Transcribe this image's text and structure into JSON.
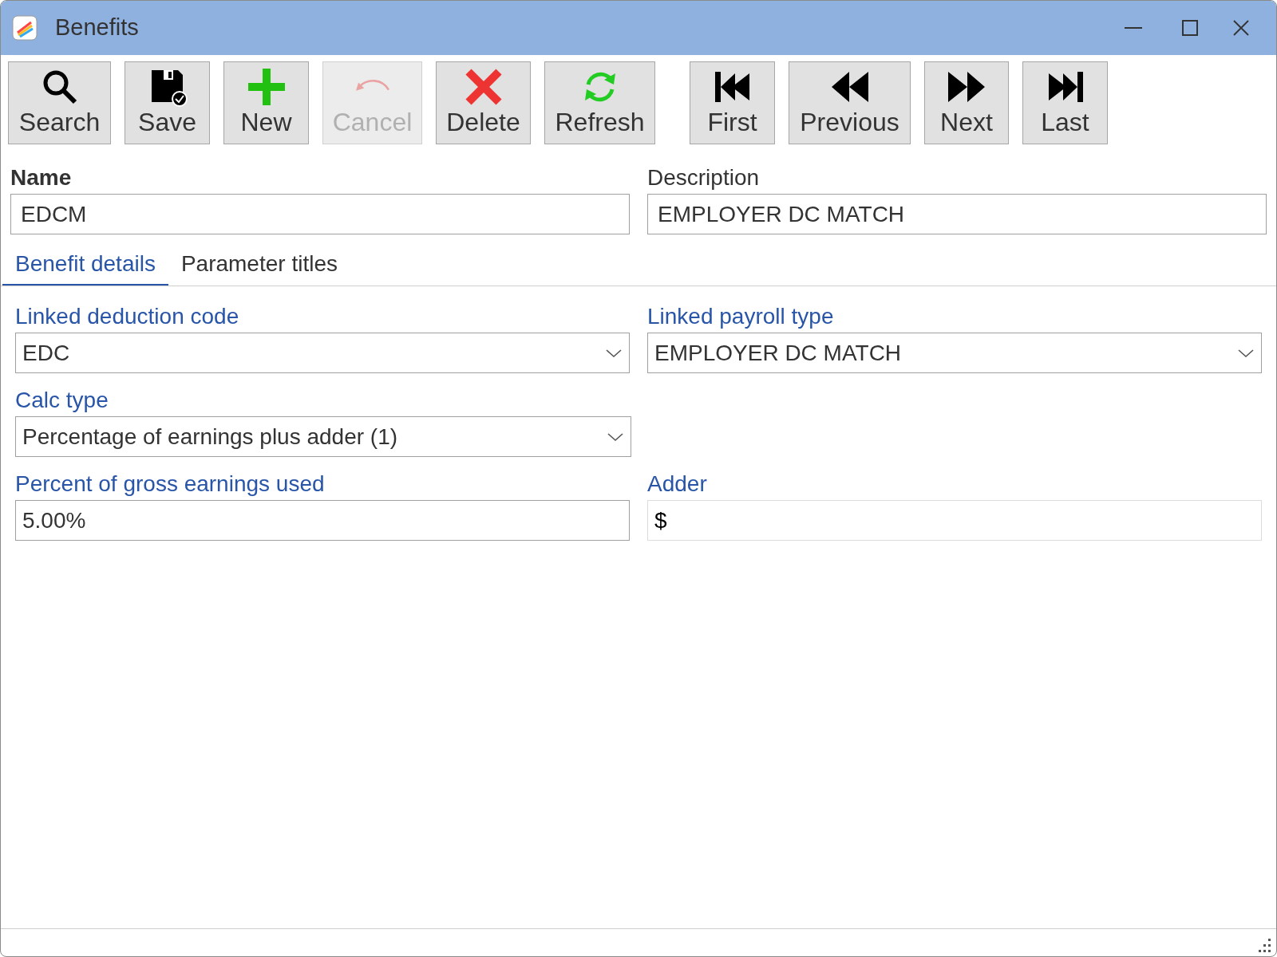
{
  "window": {
    "title": "Benefits"
  },
  "toolbar": [
    {
      "kind": "search",
      "label": "Search",
      "disabled": false
    },
    {
      "kind": "save",
      "label": "Save",
      "disabled": false
    },
    {
      "kind": "new",
      "label": "New",
      "disabled": false
    },
    {
      "kind": "cancel",
      "label": "Cancel",
      "disabled": true
    },
    {
      "kind": "delete",
      "label": "Delete",
      "disabled": false
    },
    {
      "kind": "refresh",
      "label": "Refresh",
      "disabled": false
    },
    {
      "kind": "first",
      "label": "First",
      "disabled": false
    },
    {
      "kind": "previous",
      "label": "Previous",
      "disabled": false
    },
    {
      "kind": "next",
      "label": "Next",
      "disabled": false
    },
    {
      "kind": "last",
      "label": "Last",
      "disabled": false
    }
  ],
  "header_fields": [
    {
      "label": "Name",
      "value": "EDCM"
    },
    {
      "label": "Description",
      "value": "EMPLOYER DC MATCH"
    }
  ],
  "tabs": [
    {
      "label": "Benefit details",
      "selected": true
    },
    {
      "label": "Parameter titles",
      "selected": false
    }
  ],
  "detail_rows": [
    [
      {
        "kind": "dropdown",
        "label": "Linked deduction code",
        "value": "EDC"
      },
      {
        "kind": "dropdown",
        "label": "Linked payroll type",
        "value": "EMPLOYER DC MATCH"
      }
    ],
    [
      {
        "kind": "dropdown",
        "label": "Calc type",
        "value": "Percentage of earnings plus adder (1)"
      }
    ],
    [
      {
        "kind": "text",
        "label": "Percent of gross earnings used",
        "value": "5.00%"
      },
      {
        "kind": "currency",
        "label": "Adder",
        "value": "$"
      }
    ]
  ]
}
